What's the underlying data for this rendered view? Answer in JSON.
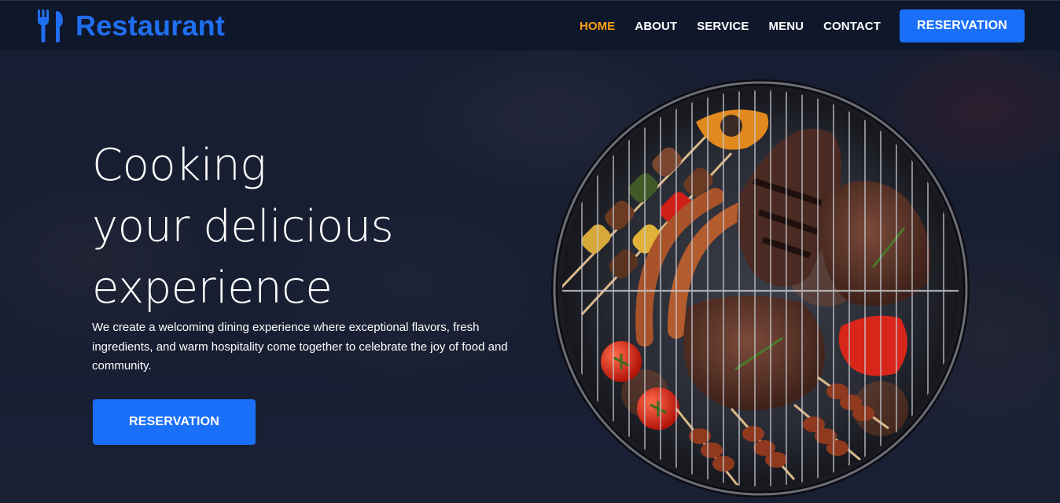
{
  "brand": {
    "name": "Restaurant",
    "icon": "utensils-icon",
    "color": "#1f6ff0"
  },
  "nav": {
    "items": [
      {
        "label": "HOME",
        "active": true
      },
      {
        "label": "ABOUT",
        "active": false
      },
      {
        "label": "SERVICE",
        "active": false
      },
      {
        "label": "MENU",
        "active": false
      },
      {
        "label": "CONTACT",
        "active": false
      }
    ],
    "cta_label": "RESERVATION",
    "active_color": "#fea116"
  },
  "hero": {
    "title_lines": [
      "Cooking",
      "your delicious",
      "experience"
    ],
    "description": "We create a welcoming dining experience where exceptional flavors, fresh ingredients, and warm hospitality come together to celebrate the joy of food and community.",
    "cta_label": "RESERVATION",
    "image": "barbecue-grill-image"
  },
  "colors": {
    "primary": "#1a6ff9",
    "navbar_bg": "#0f172b",
    "accent": "#fea116"
  }
}
